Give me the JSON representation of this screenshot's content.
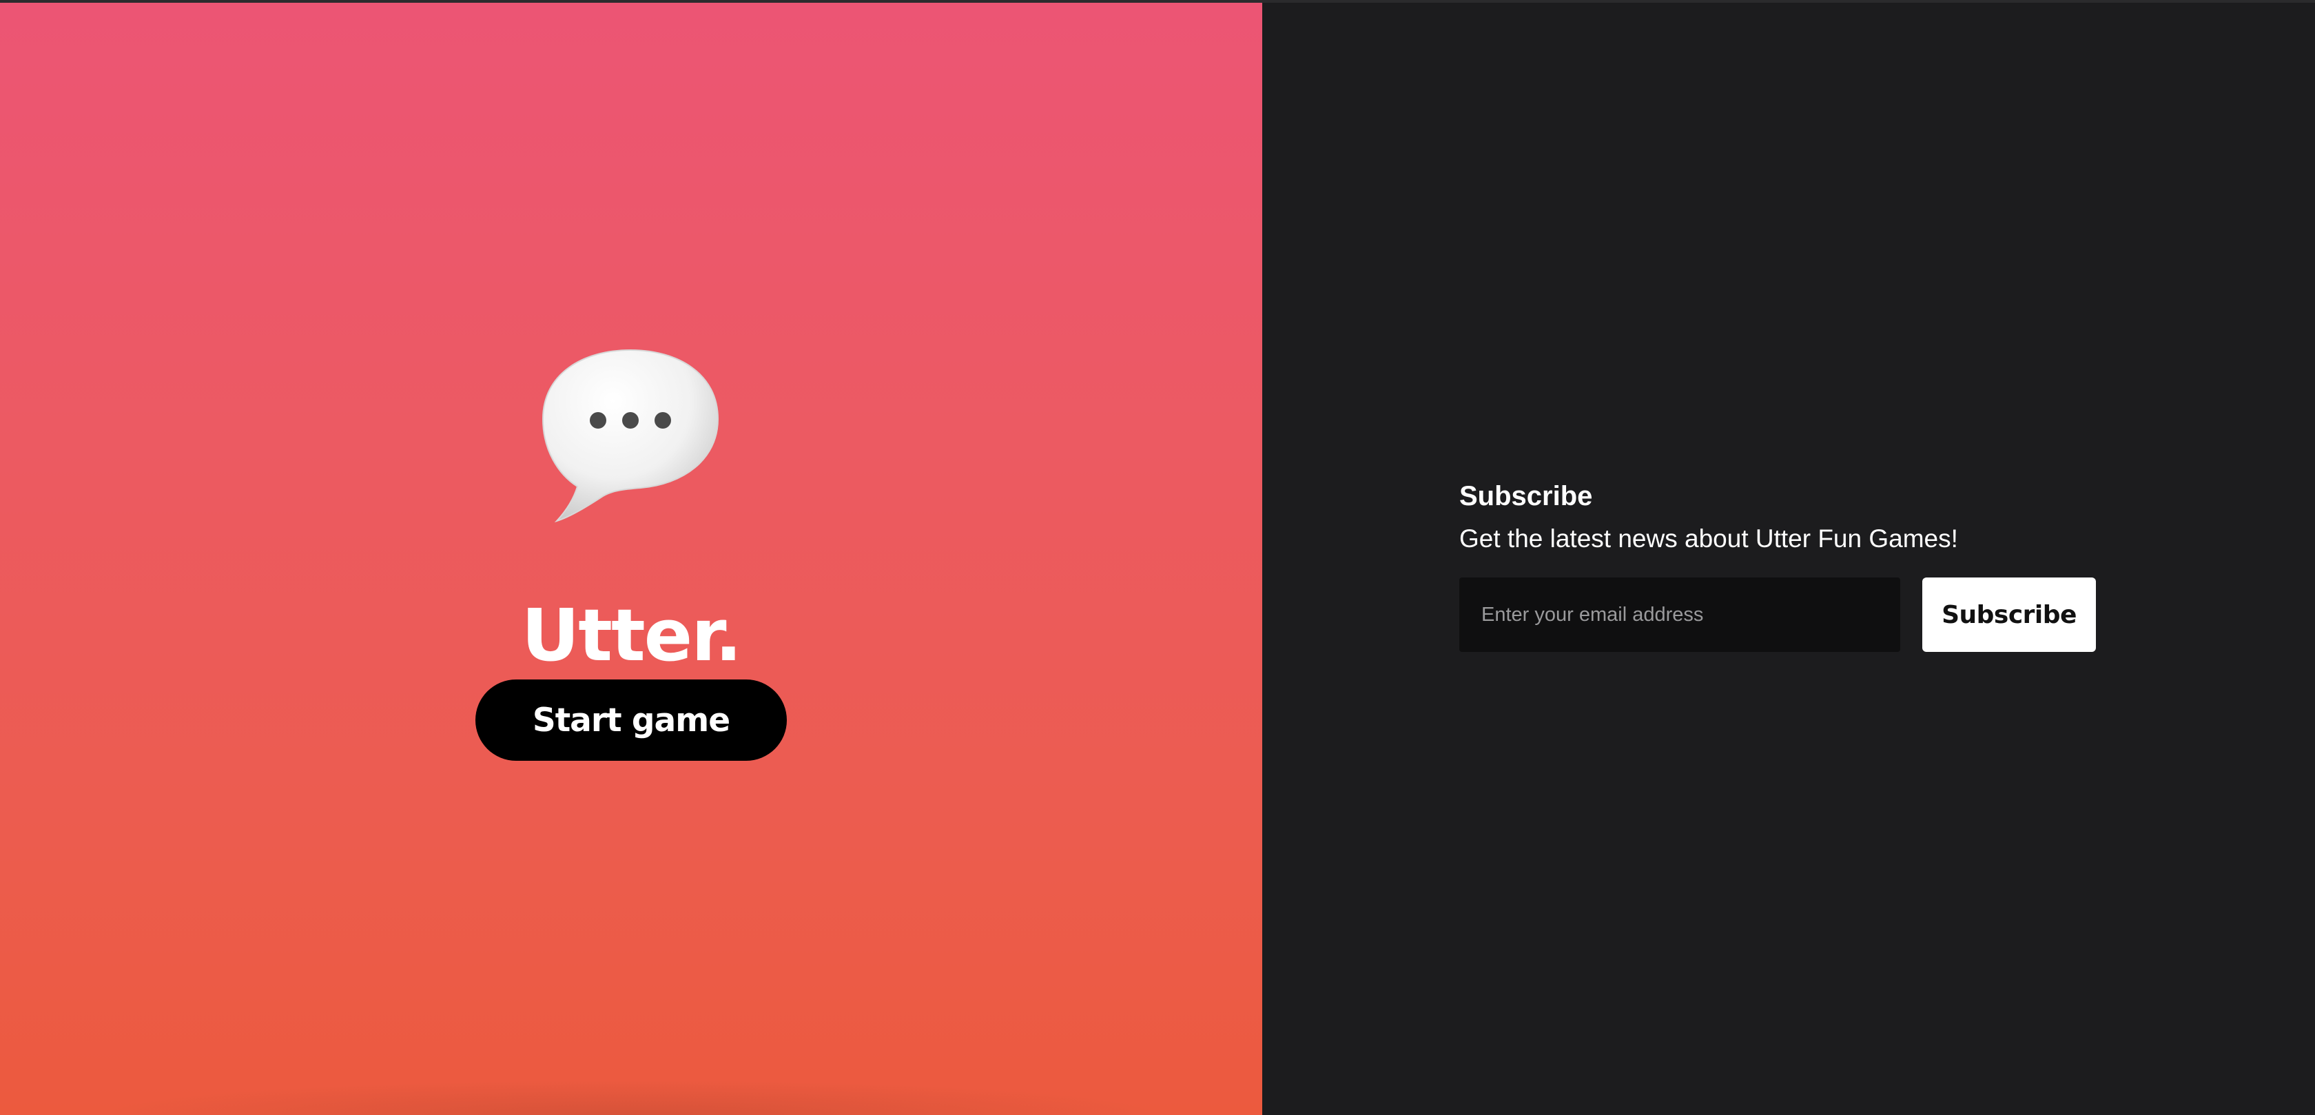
{
  "game": {
    "title": "Utter.",
    "icon": "speech-bubble-ellipsis-icon",
    "start_label": "Start game"
  },
  "newsletter": {
    "heading": "Subscribe",
    "description": "Get the latest news about Utter Fun Games!",
    "email_placeholder": "Enter your email address",
    "email_value": "",
    "button_label": "Subscribe"
  },
  "colors": {
    "gradient_top": "#ec5574",
    "gradient_bottom": "#ec5a3e",
    "dark_panel": "#1c1c1e",
    "input_bg": "#0f0f10",
    "button_dark": "#000000",
    "button_light": "#ffffff"
  }
}
